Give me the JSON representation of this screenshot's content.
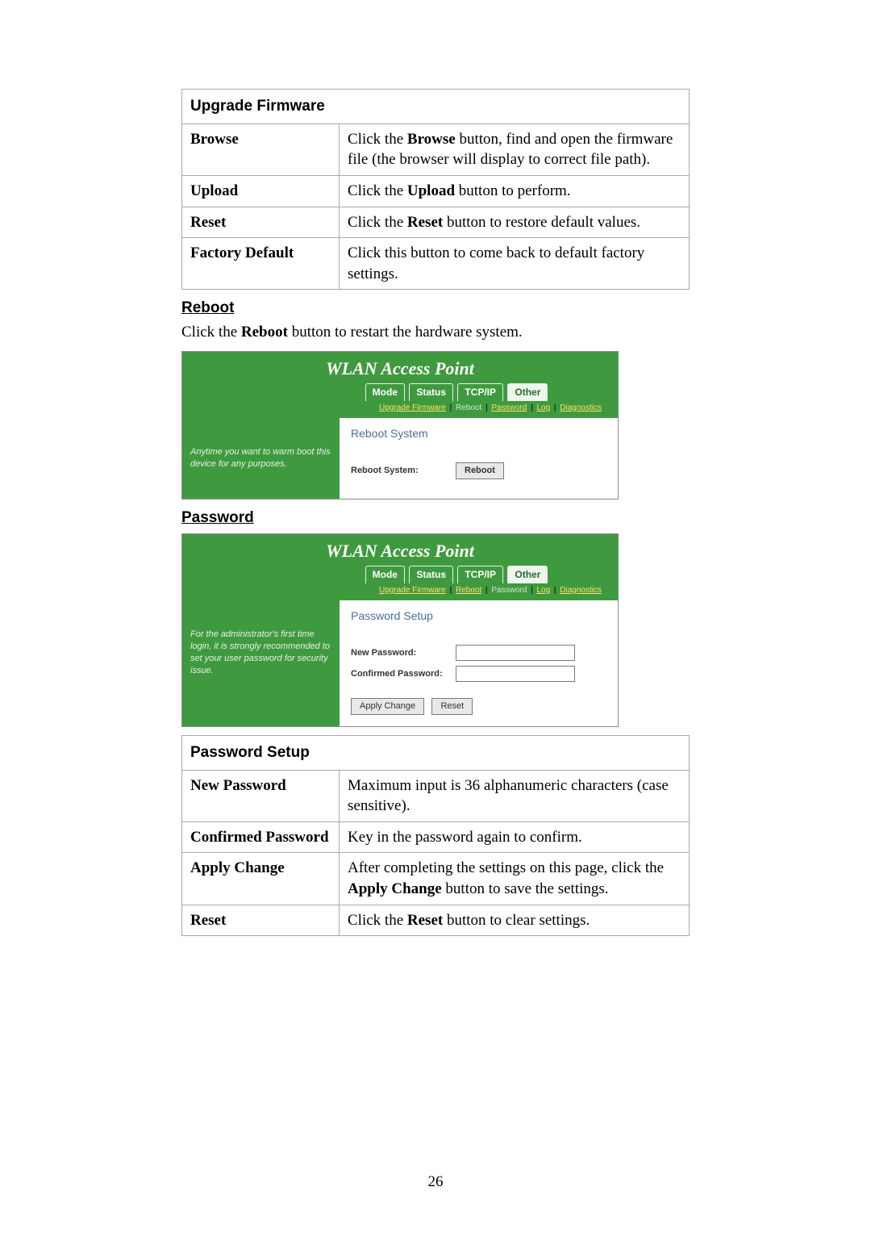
{
  "page_number": "26",
  "upgrade_firmware": {
    "title": "Upgrade Firmware",
    "rows": {
      "browse": {
        "key": "Browse",
        "desc_pre": "Click the ",
        "bold": "Browse",
        "desc_post": " button, find and open the firmware file (the browser will display to correct file path)."
      },
      "upload": {
        "key": "Upload",
        "desc_pre": "Click the ",
        "bold": "Upload",
        "desc_post": " button to perform."
      },
      "reset": {
        "key": "Reset",
        "desc_pre": "Click the ",
        "bold": "Reset",
        "desc_post": " button to restore default values."
      },
      "factory": {
        "key": "Factory Default",
        "desc": "Click this button to come back to default factory settings."
      }
    }
  },
  "reboot": {
    "heading": "Reboot",
    "para_pre": "Click the ",
    "para_bold": "Reboot",
    "para_post": " button to restart the hardware system."
  },
  "password": {
    "heading": "Password"
  },
  "ui": {
    "banner": "WLAN Access Point",
    "tabs": {
      "mode": "Mode",
      "status": "Status",
      "tcpip": "TCP/IP",
      "other": "Other"
    },
    "sublinks": {
      "upgrade": "Upgrade Firmware",
      "reboot": "Reboot",
      "password": "Password",
      "log": "Log",
      "diagnostics": "Diagnostics"
    }
  },
  "shot_reboot": {
    "side": "Anytime you want to warm boot this device for any purposes.",
    "title": "Reboot System",
    "label": "Reboot System:",
    "button": "Reboot"
  },
  "shot_password": {
    "side": "For the administrator's first time login, it is strongly recommended to set your user password for security issue.",
    "title": "Password Setup",
    "label_new": "New Password:",
    "label_conf": "Confirmed Password:",
    "btn_apply": "Apply Change",
    "btn_reset": "Reset"
  },
  "password_setup_table": {
    "title": "Password Setup",
    "rows": {
      "newpw": {
        "key": "New Password",
        "desc": "Maximum input is 36 alphanumeric characters (case sensitive)."
      },
      "confpw": {
        "key": "Confirmed Password",
        "desc": "Key in the password again to confirm."
      },
      "apply": {
        "key": "Apply Change",
        "desc_pre": "After completing the settings on this page, click the ",
        "bold": "Apply Change",
        "desc_post": " button to save the settings."
      },
      "reset": {
        "key": "Reset",
        "desc_pre": "Click the ",
        "bold": "Reset",
        "desc_post": " button to clear settings."
      }
    }
  }
}
